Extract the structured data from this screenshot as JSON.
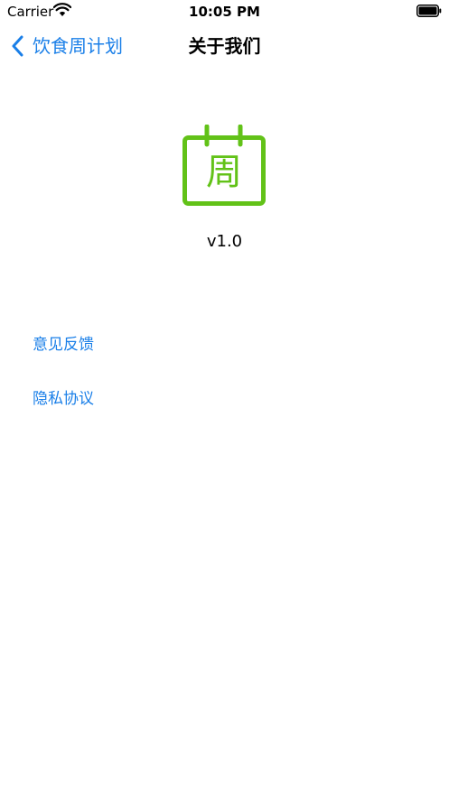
{
  "status_bar": {
    "carrier": "Carrier",
    "time": "10:05 PM",
    "wifi_icon": "wifi-icon",
    "battery_icon": "battery-icon"
  },
  "nav": {
    "back_label": "饮食周计划",
    "title": "关于我们",
    "back_icon": "chevron-left-icon"
  },
  "about": {
    "app_icon_glyph": "周",
    "version": "v1.0"
  },
  "links": {
    "feedback": "意见反馈",
    "privacy": "隐私协议"
  },
  "colors": {
    "accent": "#1a7fe8",
    "icon_green": "#62c218"
  }
}
